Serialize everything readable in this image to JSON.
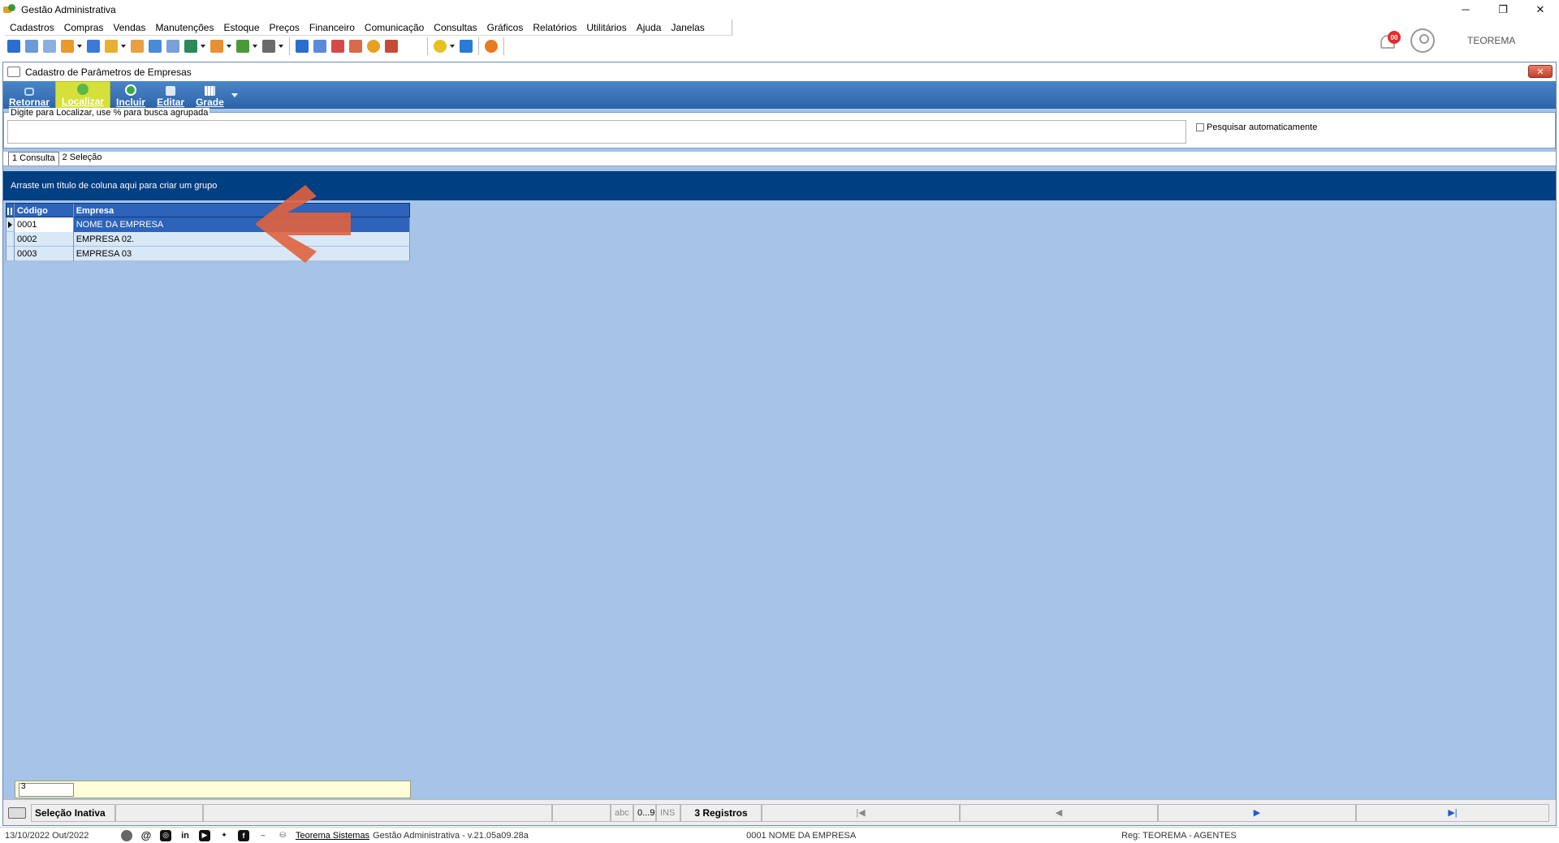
{
  "window": {
    "title": "Gestão Administrativa",
    "minimize": "─",
    "restore": "❐",
    "close": "✕"
  },
  "menu": [
    "Cadastros",
    "Compras",
    "Vendas",
    "Manutenções",
    "Estoque",
    "Preços",
    "Financeiro",
    "Comunicação",
    "Consultas",
    "Gráficos",
    "Relatórios",
    "Utilitários",
    "Ajuda",
    "Janelas"
  ],
  "header": {
    "notifications_badge": "00",
    "user_name": "TEOREMA"
  },
  "form": {
    "title": "Cadastro de Parâmetros de Empresas",
    "close_label": "✕",
    "toolbar": {
      "retornar": "Retornar",
      "localizar": "Localizar",
      "incluir": "Incluir",
      "editar": "Editar",
      "grade": "Grade"
    },
    "search": {
      "legend": "Digite para Localizar, use % para busca agrupada",
      "value": "",
      "auto_label": "Pesquisar automaticamente"
    },
    "tabs": [
      "1 Consulta",
      "2 Seleção"
    ],
    "group_panel_text": "Arraste um título de coluna aqui para criar um grupo",
    "grid": {
      "columns": [
        "Código",
        "Empresa"
      ],
      "rows": [
        {
          "codigo": "0001",
          "empresa": "NOME DA EMPRESA"
        },
        {
          "codigo": "0002",
          "empresa": "EMPRESA 02."
        },
        {
          "codigo": "0003",
          "empresa": "EMPRESA 03"
        }
      ]
    },
    "footer_count": "3"
  },
  "statusbar": {
    "selection": "Seleção Inativa",
    "mode_abc": "abc",
    "mode_num": "0...9",
    "mode_ins": "INS",
    "records": "3 Registros",
    "nav_first": "|◀",
    "nav_prev": "◀",
    "nav_next": "▶",
    "nav_last": "▶|"
  },
  "app_status": {
    "date": "13/10/2022 Out/2022",
    "company_link": "Teorema Sistemas",
    "version": "Gestão Administrativa - v.21.05a09.28a",
    "current_company": "0001 NOME DA EMPRESA",
    "reg": "Reg: TEOREMA - AGENTES"
  },
  "colors": {
    "accent": "#2d63b8",
    "group_panel": "#003f82",
    "workspace": "#a6c3e8",
    "highlight": "#d6e03a",
    "annotation_arrow": "#e0623e"
  }
}
